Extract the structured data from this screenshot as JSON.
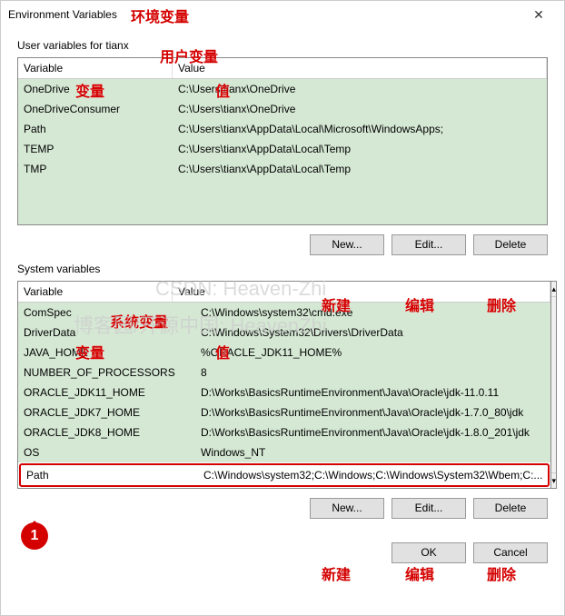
{
  "window": {
    "title": "Environment Variables"
  },
  "annotations": {
    "title_cn": "环境变量",
    "user_vars_cn": "用户变量",
    "var_cn": "变量",
    "val_cn": "值",
    "sys_vars_cn": "系统变量",
    "new_cn": "新建",
    "edit_cn": "编辑",
    "delete_cn": "删除",
    "marker1": "1"
  },
  "watermarks": {
    "line1": "CSDN: Heaven-Zhi",
    "line2": "博客园/开源中国: HeavenZhi"
  },
  "user_section": {
    "label": "User variables for tianx",
    "columns": {
      "variable": "Variable",
      "value": "Value"
    },
    "rows": [
      {
        "variable": "OneDrive",
        "value": "C:\\Users\\tianx\\OneDrive"
      },
      {
        "variable": "OneDriveConsumer",
        "value": "C:\\Users\\tianx\\OneDrive"
      },
      {
        "variable": "Path",
        "value": "C:\\Users\\tianx\\AppData\\Local\\Microsoft\\WindowsApps;"
      },
      {
        "variable": "TEMP",
        "value": "C:\\Users\\tianx\\AppData\\Local\\Temp"
      },
      {
        "variable": "TMP",
        "value": "C:\\Users\\tianx\\AppData\\Local\\Temp"
      }
    ]
  },
  "system_section": {
    "label": "System variables",
    "columns": {
      "variable": "Variable",
      "value": "Value"
    },
    "rows": [
      {
        "variable": "ComSpec",
        "value": "C:\\Windows\\system32\\cmd.exe"
      },
      {
        "variable": "DriverData",
        "value": "C:\\Windows\\System32\\Drivers\\DriverData"
      },
      {
        "variable": "JAVA_HOME",
        "value": "%ORACLE_JDK11_HOME%"
      },
      {
        "variable": "NUMBER_OF_PROCESSORS",
        "value": "8"
      },
      {
        "variable": "ORACLE_JDK11_HOME",
        "value": "D:\\Works\\BasicsRuntimeEnvironment\\Java\\Oracle\\jdk-11.0.11"
      },
      {
        "variable": "ORACLE_JDK7_HOME",
        "value": "D:\\Works\\BasicsRuntimeEnvironment\\Java\\Oracle\\jdk-1.7.0_80\\jdk"
      },
      {
        "variable": "ORACLE_JDK8_HOME",
        "value": "D:\\Works\\BasicsRuntimeEnvironment\\Java\\Oracle\\jdk-1.8.0_201\\jdk"
      },
      {
        "variable": "OS",
        "value": "Windows_NT"
      }
    ],
    "selected_row": {
      "variable": "Path",
      "value": "C:\\Windows\\system32;C:\\Windows;C:\\Windows\\System32\\Wbem;C:..."
    }
  },
  "buttons": {
    "new": "New...",
    "edit": "Edit...",
    "delete": "Delete",
    "ok": "OK",
    "cancel": "Cancel"
  }
}
